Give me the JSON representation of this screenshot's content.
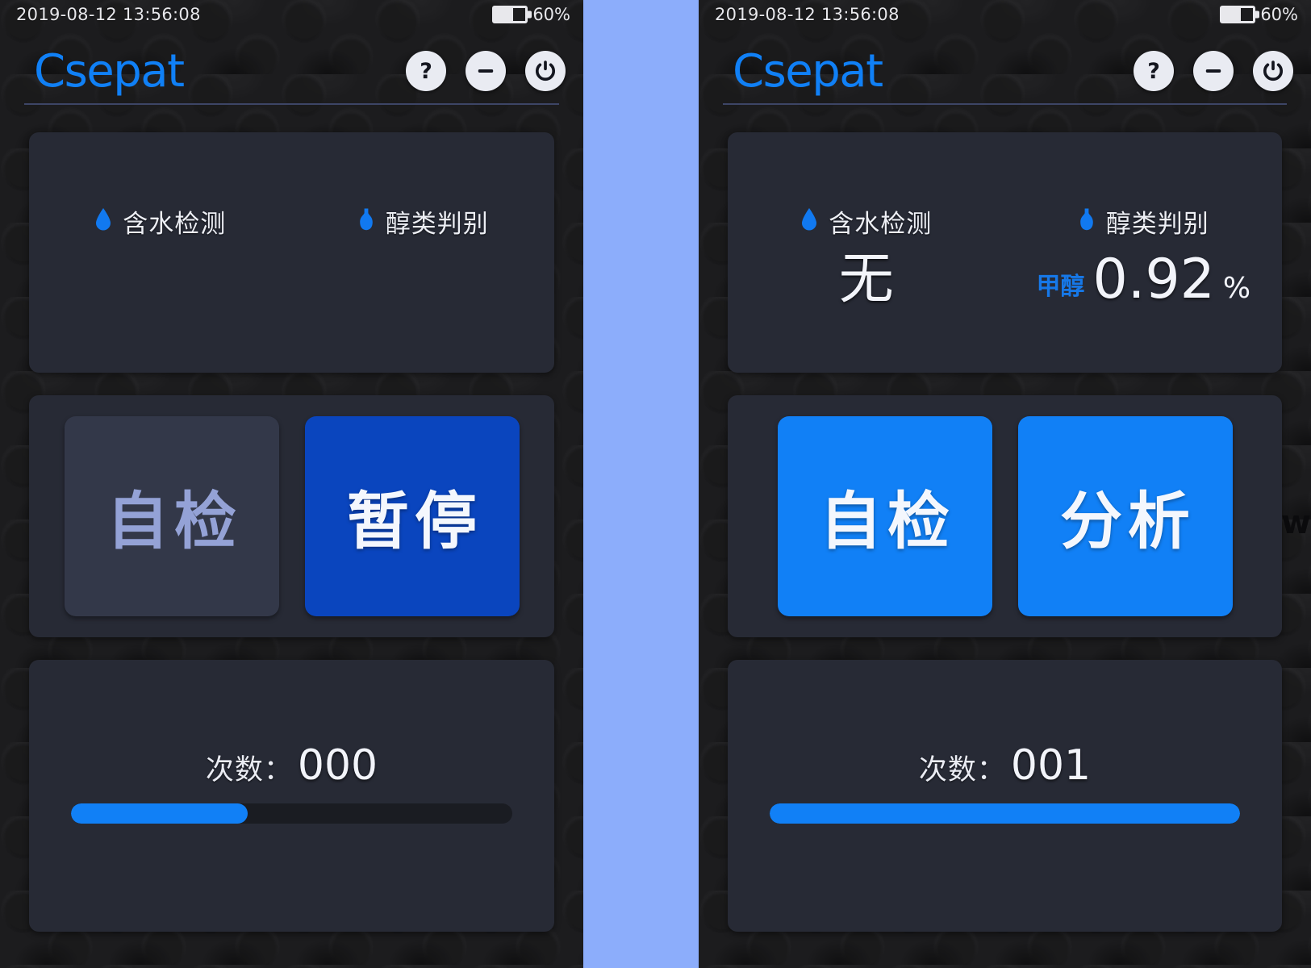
{
  "theme": {
    "accent_blue": "#1180F6",
    "accent_blue_dark": "#0A45BE",
    "panel_bg": "#272A35",
    "device_bg": "#1C1C1E",
    "gap_blue": "#8CADFB",
    "text_light": "#F2F4FA",
    "text_disabled": "#94A2D6"
  },
  "edge_glyph": "w",
  "panels": [
    {
      "id": "left",
      "status": {
        "datetime": "2019-08-12 13:56:08",
        "battery_percent": "60%",
        "battery_level": 60
      },
      "appbar": {
        "brand": "Csepat",
        "icons": [
          {
            "name": "help-icon",
            "label": "?"
          },
          {
            "name": "minimize-icon",
            "label": "−"
          },
          {
            "name": "power-icon",
            "label": "⏻"
          }
        ]
      },
      "result": {
        "water": {
          "icon": "water-drop-icon",
          "label": "含水检测",
          "value": "",
          "prefix": "",
          "unit": ""
        },
        "alcohol": {
          "icon": "bottle-icon",
          "label": "醇类判别",
          "value": "",
          "prefix": "",
          "unit": ""
        }
      },
      "buttons": [
        {
          "name": "self-check-button",
          "label": "自检",
          "state": "disabled"
        },
        {
          "name": "pause-button",
          "label": "暂停",
          "state": "dark"
        }
      ],
      "counter": {
        "label": "次数：",
        "value": "000",
        "progress_percent": 40
      }
    },
    {
      "id": "right",
      "status": {
        "datetime": "2019-08-12 13:56:08",
        "battery_percent": "60%",
        "battery_level": 60
      },
      "appbar": {
        "brand": "Csepat",
        "icons": [
          {
            "name": "help-icon",
            "label": "?"
          },
          {
            "name": "minimize-icon",
            "label": "−"
          },
          {
            "name": "power-icon",
            "label": "⏻"
          }
        ]
      },
      "result": {
        "water": {
          "icon": "water-drop-icon",
          "label": "含水检测",
          "value": "无",
          "prefix": "",
          "unit": ""
        },
        "alcohol": {
          "icon": "bottle-icon",
          "label": "醇类判别",
          "value": "0.92",
          "prefix": "甲醇",
          "unit": "%"
        }
      },
      "buttons": [
        {
          "name": "self-check-button",
          "label": "自检",
          "state": "primary"
        },
        {
          "name": "analyze-button",
          "label": "分析",
          "state": "primary"
        }
      ],
      "counter": {
        "label": "次数：",
        "value": "001",
        "progress_percent": 100
      }
    }
  ]
}
